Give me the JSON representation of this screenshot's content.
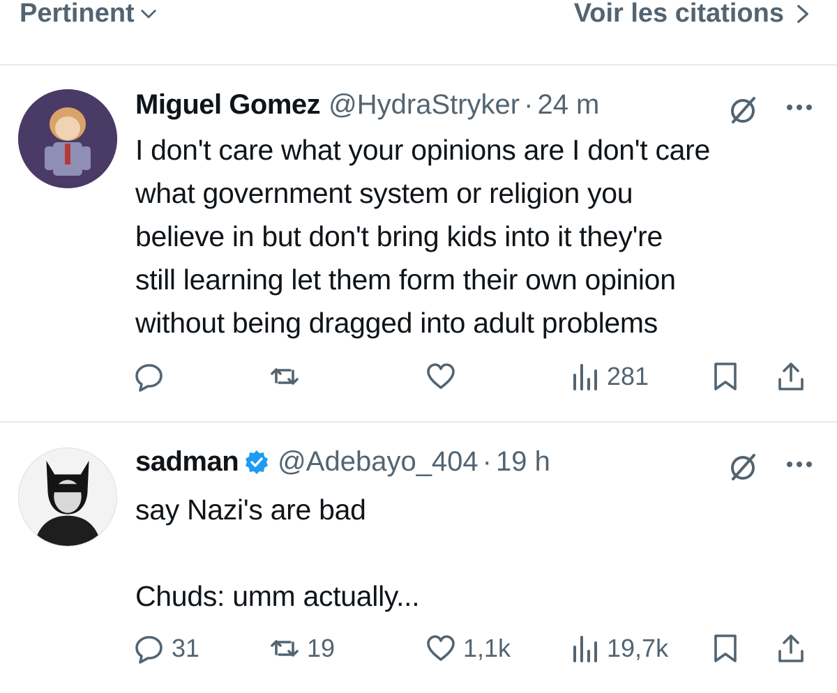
{
  "topbar": {
    "sort_label": "Pertinent",
    "quotes_label": "Voir les citations"
  },
  "tweets": [
    {
      "name": "Miguel Gomez",
      "handle": "@HydraStryker",
      "separator": "·",
      "time": "24 m",
      "verified": false,
      "text": "I don't care what your opinions are I don't care\nwhat government system or religion you\nbelieve in but don't bring kids into it they're\nstill learning let them form their own opinion\nwithout being dragged into adult problems",
      "replies": "",
      "reposts": "",
      "likes": "",
      "views": "281"
    },
    {
      "name": "sadman",
      "handle": "@Adebayo_404",
      "separator": "·",
      "time": "19 h",
      "verified": true,
      "text": "say Nazi's are bad\n\nChuds: umm actually...",
      "replies": "31",
      "reposts": "19",
      "likes": "1,1k",
      "views": "19,7k"
    }
  ],
  "colors": {
    "text": "#0f1419",
    "secondary": "#536471",
    "verified": "#1d9bf0",
    "divider": "#e6e9eb"
  },
  "icons": [
    "chevron-down-icon",
    "chevron-right-icon",
    "grok-icon",
    "more-icon",
    "reply-icon",
    "repost-icon",
    "like-icon",
    "views-icon",
    "bookmark-icon",
    "share-icon",
    "verified-badge-icon"
  ]
}
